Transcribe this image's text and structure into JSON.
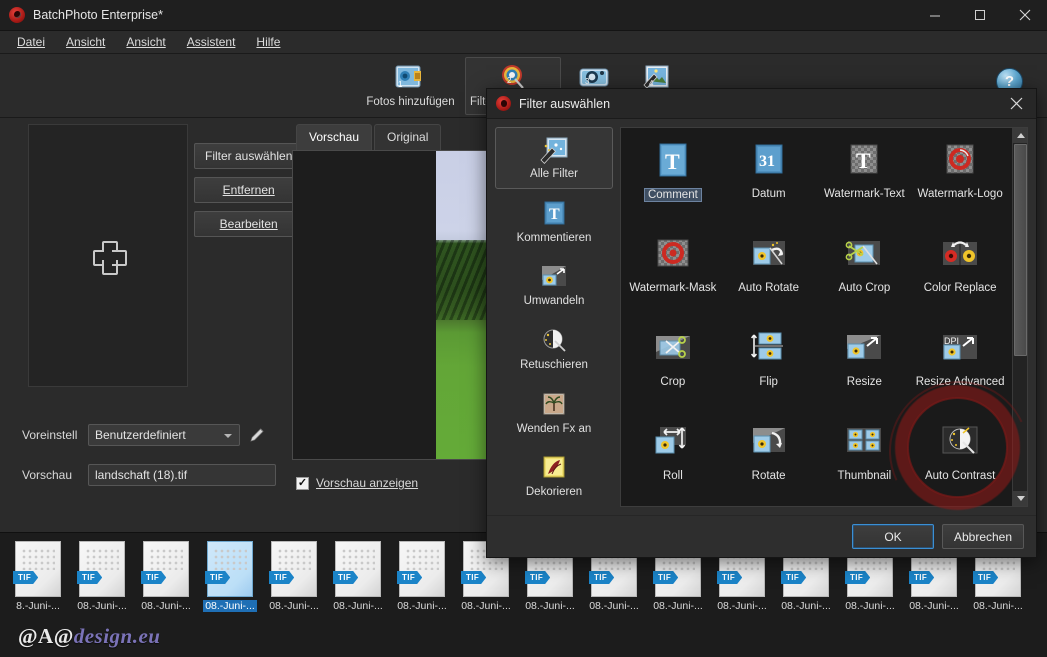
{
  "window": {
    "title": "BatchPhoto Enterprise*",
    "app_icon": "batchphoto-swirl-icon",
    "minimize": "—",
    "maximize": "□",
    "close": "✕"
  },
  "menu": {
    "items": [
      {
        "label": "Datei",
        "accel": "D"
      },
      {
        "label": "Ansicht",
        "accel": "n"
      },
      {
        "label": "Ansicht",
        "accel": "n"
      },
      {
        "label": "Assistent",
        "accel": "A"
      },
      {
        "label": "Hilfe",
        "accel": "H"
      }
    ]
  },
  "toolbar": {
    "buttons": [
      {
        "label": "Fotos hinzufügen",
        "icon": "add-photos-icon",
        "step": "1",
        "active": false
      },
      {
        "label": "Filter hinzufügen",
        "icon": "add-filter-icon",
        "step": "2",
        "active": true
      },
      {
        "label": "",
        "icon": "camera-icon",
        "step": "3",
        "active": false
      },
      {
        "label": "",
        "icon": "process-icon",
        "step": "4",
        "active": false
      }
    ],
    "help_label": "?",
    "help_icon": "help-icon"
  },
  "left_panel": {
    "dropzone_icon": "add-plus-icon",
    "buttons": [
      {
        "label": "Filter auswählen",
        "accel": ""
      },
      {
        "label": "Entfernen",
        "accel": "E"
      },
      {
        "label": "Bearbeiten",
        "accel": "B"
      }
    ],
    "preset_label": "Voreinstell",
    "preset_value": "Benutzerdefiniert",
    "edit_icon": "pencil-icon",
    "preview_label": "Vorschau",
    "preview_value": "landschaft (18).tif"
  },
  "preview_pane": {
    "tabs": [
      {
        "label": "Vorschau",
        "selected": true
      },
      {
        "label": "Original",
        "selected": false
      }
    ],
    "show_preview_label": "Vorschau anzeigen",
    "show_preview_accel": "o",
    "show_preview_checked": true,
    "checkmark": "✓"
  },
  "filmstrip": {
    "items": [
      {
        "name": "8.-Juni-...",
        "badge": "TIF",
        "selected": false
      },
      {
        "name": "08.-Juni-...",
        "badge": "TIF",
        "selected": false
      },
      {
        "name": "08.-Juni-...",
        "badge": "TIF",
        "selected": false
      },
      {
        "name": "08.-Juni-...",
        "badge": "TIF",
        "selected": true
      },
      {
        "name": "08.-Juni-...",
        "badge": "TIF",
        "selected": false
      },
      {
        "name": "08.-Juni-...",
        "badge": "TIF",
        "selected": false
      },
      {
        "name": "08.-Juni-...",
        "badge": "TIF",
        "selected": false
      },
      {
        "name": "08.-Juni-...",
        "badge": "TIF",
        "selected": false
      },
      {
        "name": "08.-Juni-...",
        "badge": "TIF",
        "selected": false
      },
      {
        "name": "08.-Juni-...",
        "badge": "TIF",
        "selected": false
      },
      {
        "name": "08.-Juni-...",
        "badge": "TIF",
        "selected": false
      },
      {
        "name": "08.-Juni-...",
        "badge": "TIF",
        "selected": false
      },
      {
        "name": "08.-Juni-...",
        "badge": "TIF",
        "selected": false
      },
      {
        "name": "08.-Juni-...",
        "badge": "TIF",
        "selected": false
      },
      {
        "name": "08.-Juni-...",
        "badge": "TIF",
        "selected": false
      },
      {
        "name": "08.-Juni-...",
        "badge": "TIF",
        "selected": false
      }
    ]
  },
  "watermark": {
    "prefix": "@A@",
    "text": "design.eu"
  },
  "dialog": {
    "title": "Filter auswählen",
    "icon": "batchphoto-swirl-icon",
    "close_icon": "close-icon",
    "categories": [
      {
        "label": "Alle Filter",
        "icon": "all-filters-icon",
        "selected": true
      },
      {
        "label": "Kommentieren",
        "icon": "text-t-icon",
        "selected": false
      },
      {
        "label": "Umwandeln",
        "icon": "transform-icon",
        "selected": false
      },
      {
        "label": "Retuschieren",
        "icon": "retouch-icon",
        "selected": false
      },
      {
        "label": "Wenden Fx an",
        "icon": "effects-palm-icon",
        "selected": false
      },
      {
        "label": "Dekorieren",
        "icon": "decorate-icon",
        "selected": false
      }
    ],
    "filters": [
      {
        "label": "Comment",
        "icon": "comment-t-icon",
        "selected": true
      },
      {
        "label": "Datum",
        "icon": "date-31-icon",
        "selected": false
      },
      {
        "label": "Watermark-Text",
        "icon": "watermark-text-icon",
        "selected": false
      },
      {
        "label": "Watermark-Logo",
        "icon": "watermark-logo-icon",
        "selected": false
      },
      {
        "label": "Watermark-Mask",
        "icon": "watermark-mask-icon",
        "selected": false
      },
      {
        "label": "Auto Rotate",
        "icon": "auto-rotate-icon",
        "selected": false
      },
      {
        "label": "Auto Crop",
        "icon": "auto-crop-icon",
        "selected": false
      },
      {
        "label": "Color Replace",
        "icon": "color-replace-icon",
        "selected": false
      },
      {
        "label": "Crop",
        "icon": "crop-icon",
        "selected": false
      },
      {
        "label": "Flip",
        "icon": "flip-icon",
        "selected": false
      },
      {
        "label": "Resize",
        "icon": "resize-icon",
        "selected": false
      },
      {
        "label": "Resize Advanced",
        "icon": "resize-advanced-icon",
        "selected": false
      },
      {
        "label": "Roll",
        "icon": "roll-icon",
        "selected": false
      },
      {
        "label": "Rotate",
        "icon": "rotate-icon",
        "selected": false
      },
      {
        "label": "Thumbnail",
        "icon": "thumbnail-icon",
        "selected": false
      },
      {
        "label": "Auto Contrast",
        "icon": "auto-contrast-icon",
        "selected": false
      }
    ],
    "ok_label": "OK",
    "cancel_label": "Abbrechen",
    "scrollbar": {
      "up_icon": "scroll-up-icon",
      "down_icon": "scroll-down-icon"
    }
  },
  "colors": {
    "accent_blue": "#1b84c8",
    "window_bg": "#2b2b2b",
    "dialog_bg": "#2e2e2e",
    "grid_bg": "#1a1a1a",
    "brand_red": "#a81a16",
    "watermark_purple": "#7b73b8"
  }
}
